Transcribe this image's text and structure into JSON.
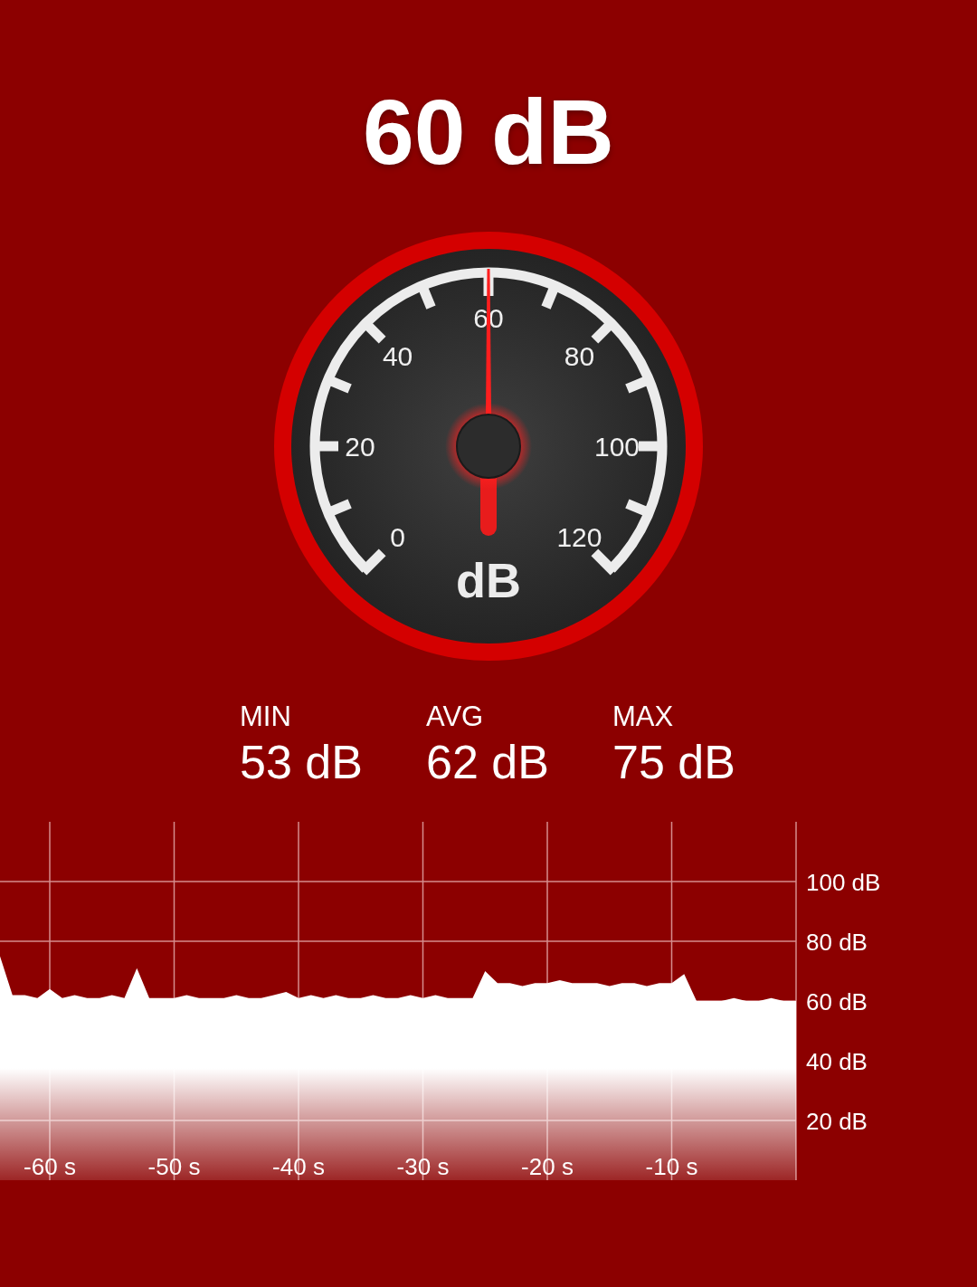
{
  "reading": "60 dB",
  "gauge": {
    "unit": "dB",
    "ticks": [
      "0",
      "20",
      "40",
      "60",
      "80",
      "100",
      "120"
    ]
  },
  "stats": [
    {
      "label": "MIN",
      "value": "53 dB"
    },
    {
      "label": "AVG",
      "value": "62 dB"
    },
    {
      "label": "MAX",
      "value": "75 dB"
    }
  ],
  "chart_data": {
    "type": "area",
    "grid": true,
    "xlim": [
      -64,
      0
    ],
    "ylim": [
      0,
      120
    ],
    "xticks": [
      {
        "value": -60,
        "label": "-60 s"
      },
      {
        "value": -50,
        "label": "-50 s"
      },
      {
        "value": -40,
        "label": "-40 s"
      },
      {
        "value": -30,
        "label": "-30 s"
      },
      {
        "value": -20,
        "label": "-20 s"
      },
      {
        "value": -10,
        "label": "-10 s"
      }
    ],
    "yticks": [
      {
        "value": 20,
        "label": "20 dB"
      },
      {
        "value": 40,
        "label": "40 dB"
      },
      {
        "value": 60,
        "label": "60 dB"
      },
      {
        "value": 80,
        "label": "80 dB"
      },
      {
        "value": 100,
        "label": "100 dB"
      }
    ],
    "x": [
      -64,
      -63,
      -62,
      -61,
      -60,
      -59,
      -58,
      -57,
      -56,
      -55,
      -54,
      -53,
      -52,
      -51,
      -50,
      -49,
      -48,
      -47,
      -46,
      -45,
      -44,
      -43,
      -42,
      -41,
      -40,
      -39,
      -38,
      -37,
      -36,
      -35,
      -34,
      -33,
      -32,
      -31,
      -30,
      -29,
      -28,
      -27,
      -26,
      -25,
      -24,
      -23,
      -22,
      -21,
      -20,
      -19,
      -18,
      -17,
      -16,
      -15,
      -14,
      -13,
      -12,
      -11,
      -10,
      -9,
      -8,
      -7,
      -6,
      -5,
      -4,
      -3,
      -2,
      -1,
      0
    ],
    "series": [
      {
        "color": "#ffffff",
        "values": [
          75,
          62,
          62,
          61,
          64,
          61,
          62,
          61,
          61,
          62,
          61,
          71,
          61,
          61,
          61,
          62,
          61,
          61,
          61,
          62,
          61,
          61,
          62,
          63,
          61,
          62,
          61,
          62,
          61,
          61,
          62,
          61,
          61,
          62,
          61,
          62,
          61,
          61,
          61,
          70,
          66,
          66,
          65,
          66,
          66,
          67,
          66,
          66,
          66,
          65,
          66,
          66,
          65,
          66,
          66,
          69,
          60,
          60,
          60,
          61,
          60,
          60,
          61,
          60,
          60
        ]
      }
    ]
  }
}
